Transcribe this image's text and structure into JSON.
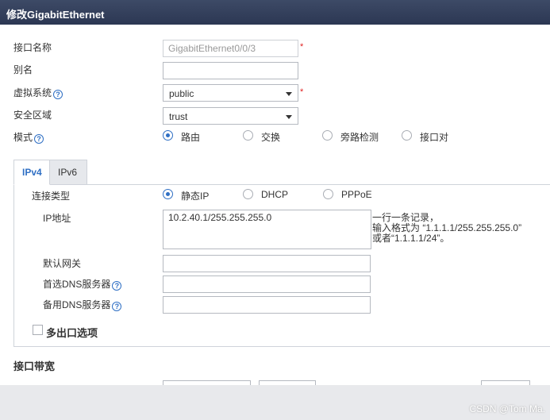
{
  "window": {
    "title": "修改GigabitEthernet"
  },
  "form": {
    "interface_name": {
      "label": "接口名称",
      "value": "GigabitEthernet0/0/3",
      "required": "*"
    },
    "alias": {
      "label": "别名",
      "value": ""
    },
    "virtual_system": {
      "label": "虚拟系统",
      "value": "public",
      "required": "*"
    },
    "security_zone": {
      "label": "安全区域",
      "value": "trust"
    },
    "mode": {
      "label": "模式",
      "options": [
        "路由",
        "交换",
        "旁路检测",
        "接口对"
      ],
      "selected": "路由"
    }
  },
  "tabs": [
    "IPv4",
    "IPv6"
  ],
  "ipv4": {
    "connection_type": {
      "label": "连接类型",
      "options": [
        "静态IP",
        "DHCP",
        "PPPoE"
      ],
      "selected": "静态IP"
    },
    "ip_address": {
      "label": "IP地址",
      "value": "10.2.40.1/255.255.255.0"
    },
    "ip_hint": [
      "一行一条记录，",
      "输入格式为 “1.1.1.1/255.255.255.0”",
      "或者“1.1.1.1/24”。"
    ],
    "default_gateway": {
      "label": "默认网关",
      "value": ""
    },
    "primary_dns": {
      "label": "首选DNS服务器",
      "value": ""
    },
    "backup_dns": {
      "label": "备用DNS服务器",
      "value": ""
    },
    "multi_egress": {
      "label": "多出口选项",
      "checked": false
    }
  },
  "bandwidth": {
    "title": "接口带宽"
  },
  "help_glyph": "?",
  "watermark": "CSDN @Tom Ma."
}
